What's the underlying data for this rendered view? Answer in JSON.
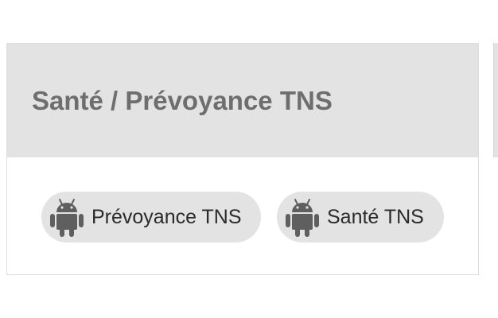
{
  "card": {
    "title": "Santé / Prévoyance TNS",
    "chips": [
      {
        "label": "Prévoyance TNS",
        "icon": "android-icon"
      },
      {
        "label": "Santé TNS",
        "icon": "android-icon"
      }
    ]
  },
  "colors": {
    "header_background": "#e3e3e3",
    "title_text": "#6e6e6e",
    "chip_background": "#e3e3e3",
    "icon": "#5f5f5f"
  }
}
